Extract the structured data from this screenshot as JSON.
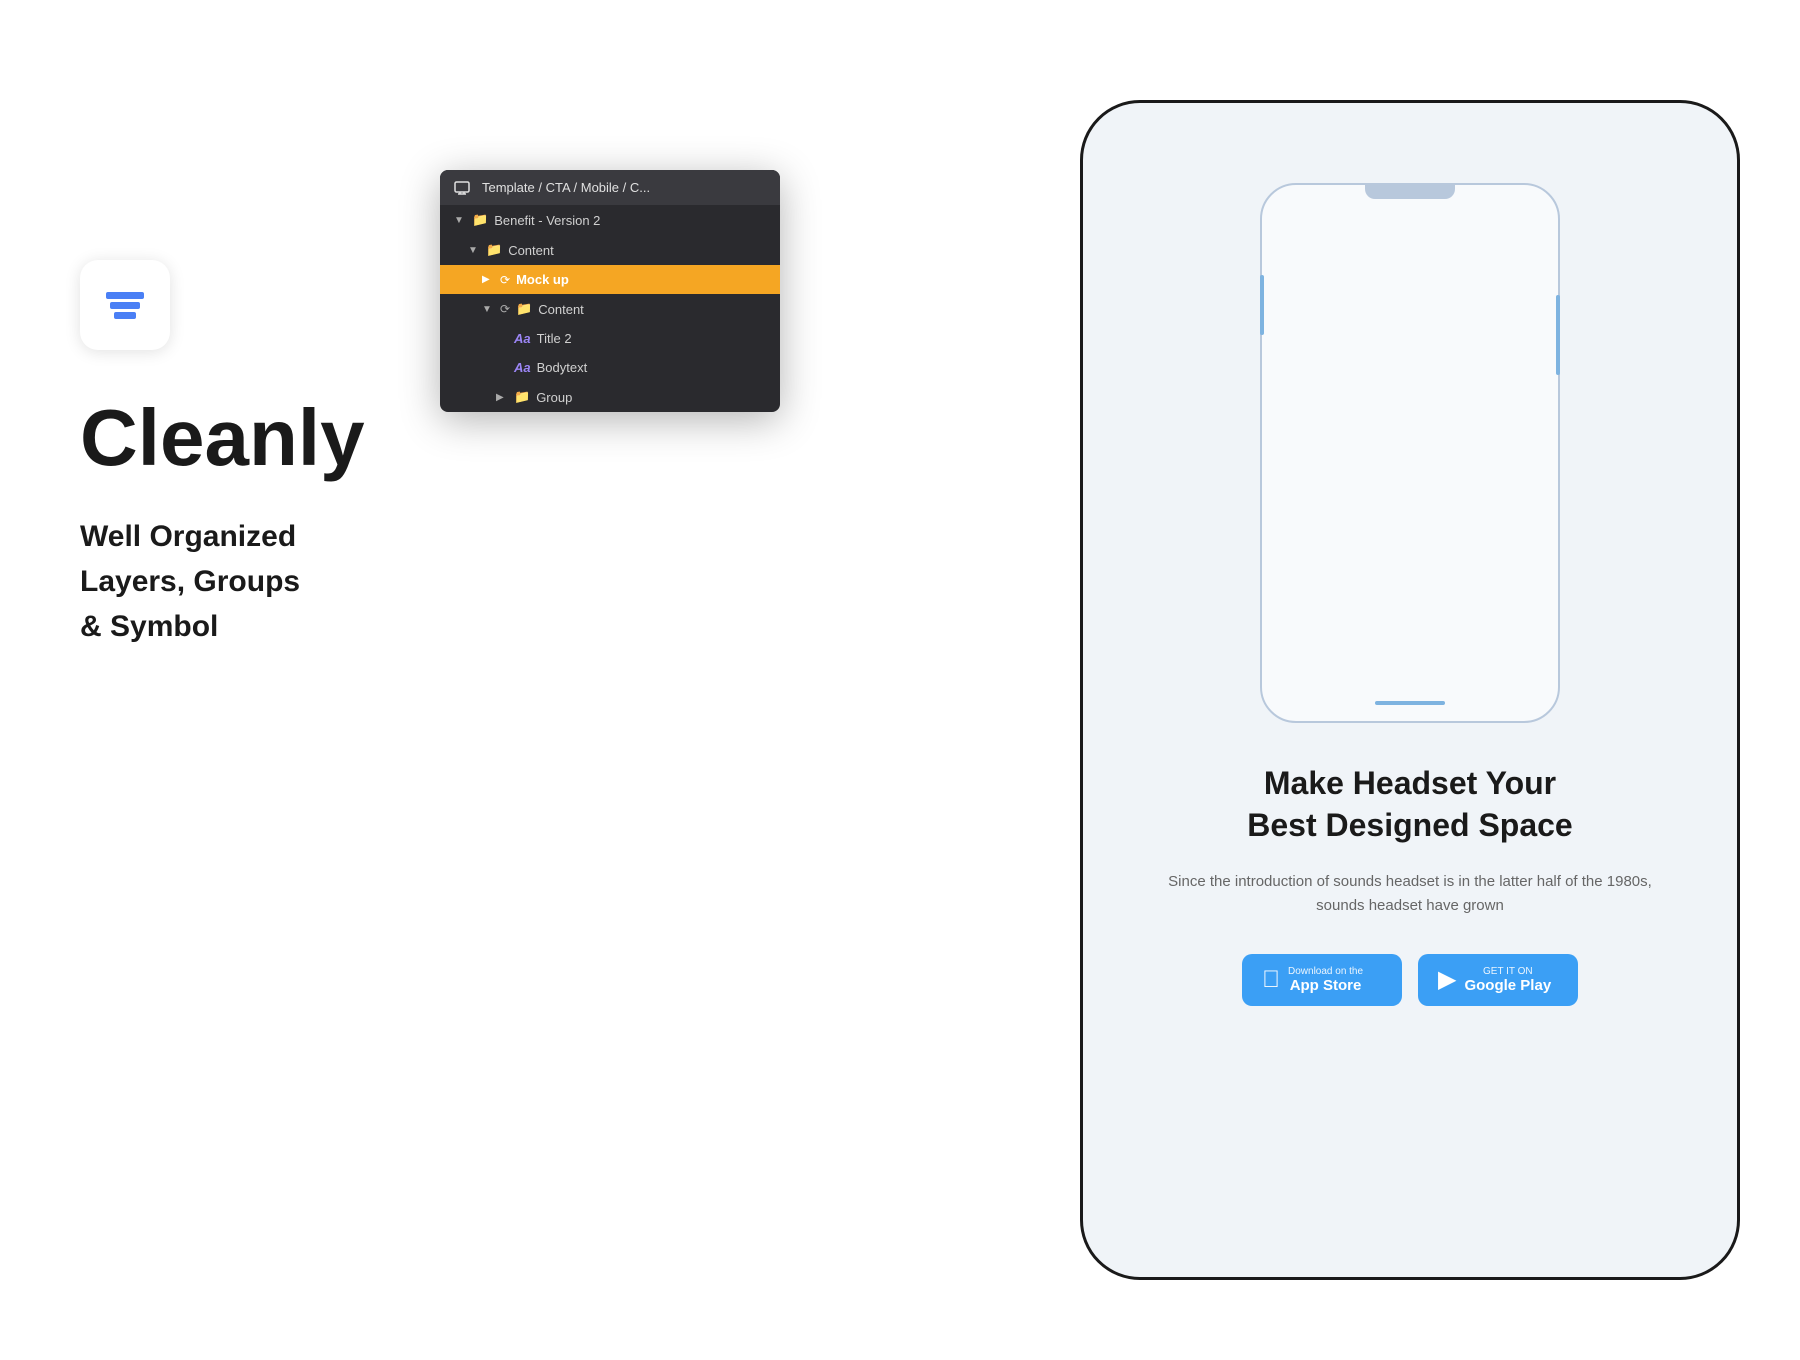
{
  "app": {
    "title": "Cleanly",
    "subtitle_line1": "Well Organized",
    "subtitle_line2": "Layers, Groups",
    "subtitle_line3": "& Symbol"
  },
  "layers_panel": {
    "header": "Template / CTA / Mobile / C...",
    "items": [
      {
        "id": 1,
        "indent": 1,
        "arrow": "open",
        "type": "folder",
        "name": "Benefit - Version 2"
      },
      {
        "id": 2,
        "indent": 2,
        "arrow": "open",
        "type": "folder",
        "name": "Content"
      },
      {
        "id": 3,
        "indent": 3,
        "arrow": "closed",
        "type": "symbol",
        "name": "Mock up",
        "highlighted": true
      },
      {
        "id": 4,
        "indent": 3,
        "arrow": "open",
        "type": "symbol",
        "name": "Content"
      },
      {
        "id": 5,
        "indent": 4,
        "arrow": null,
        "type": "text",
        "name": "Title 2"
      },
      {
        "id": 6,
        "indent": 4,
        "arrow": null,
        "type": "text",
        "name": "Bodytext"
      },
      {
        "id": 7,
        "indent": 4,
        "arrow": "closed",
        "type": "folder",
        "name": "Group"
      }
    ]
  },
  "phone": {
    "heading_line1": "Make Headset Your",
    "heading_line2": "Best Designed Space",
    "body_text": "Since the introduction of sounds headset is in the latter half of the 1980s, sounds headset have grown",
    "app_store_label_small": "Download on the",
    "app_store_label_large": "App Store",
    "google_play_label_small": "GET IT ON",
    "google_play_label_large": "Google Play"
  },
  "colors": {
    "accent_blue": "#4a7ff5",
    "highlight_orange": "#f5a623",
    "panel_bg": "#2a2a2e",
    "panel_header_bg": "#3a3a3f",
    "phone_bg": "#f0f4f8",
    "store_btn_bg": "#3b9ff5"
  }
}
